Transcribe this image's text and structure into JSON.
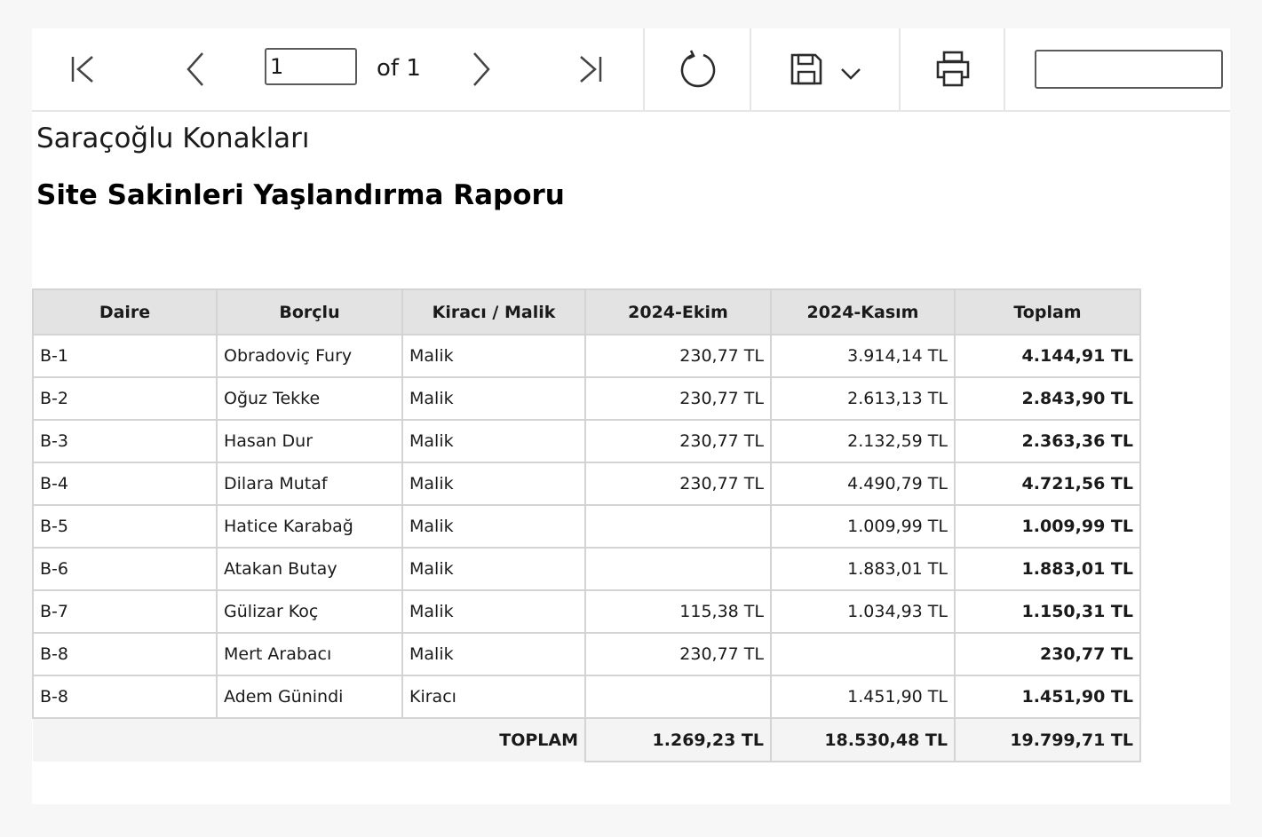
{
  "toolbar": {
    "page_value": "1",
    "page_total_label": "of 1",
    "search_value": ""
  },
  "report": {
    "company": "Saraçoğlu Konakları",
    "title": "Site Sakinleri Yaşlandırma Raporu"
  },
  "table": {
    "headers": [
      "Daire",
      "Borçlu",
      "Kiracı / Malik",
      "2024-Ekim",
      "2024-Kasım",
      "Toplam"
    ],
    "rows": [
      [
        "B-1",
        "Obradoviç Fury",
        "Malik",
        "230,77 TL",
        "3.914,14 TL",
        "4.144,91 TL"
      ],
      [
        "B-2",
        "Oğuz Tekke",
        "Malik",
        "230,77 TL",
        "2.613,13 TL",
        "2.843,90 TL"
      ],
      [
        "B-3",
        "Hasan Dur",
        "Malik",
        "230,77 TL",
        "2.132,59 TL",
        "2.363,36 TL"
      ],
      [
        "B-4",
        "Dilara Mutaf",
        "Malik",
        "230,77 TL",
        "4.490,79 TL",
        "4.721,56 TL"
      ],
      [
        "B-5",
        "Hatice Karabağ",
        "Malik",
        "",
        "1.009,99 TL",
        "1.009,99 TL"
      ],
      [
        "B-6",
        "Atakan Butay",
        "Malik",
        "",
        "1.883,01 TL",
        "1.883,01 TL"
      ],
      [
        "B-7",
        "Gülizar Koç",
        "Malik",
        "115,38 TL",
        "1.034,93 TL",
        "1.150,31 TL"
      ],
      [
        "B-8",
        "Mert Arabacı",
        "Malik",
        "230,77 TL",
        "",
        "230,77 TL"
      ],
      [
        "B-8",
        "Adem Günindi",
        "Kiracı",
        "",
        "1.451,90 TL",
        "1.451,90 TL"
      ]
    ],
    "total": {
      "label": "TOPLAM",
      "ekim": "1.269,23 TL",
      "kasim": "18.530,48 TL",
      "toplam": "19.799,71 TL"
    }
  },
  "icons": {
    "first_page": "first-page-icon",
    "previous_page": "chevron-left-icon",
    "next_page": "chevron-right-icon",
    "last_page": "last-page-icon",
    "refresh": "refresh-icon",
    "save": "save-icon",
    "save_dropdown": "chevron-down-icon",
    "print": "print-icon"
  },
  "colors": {
    "header_bg": "#e3e3e3",
    "border": "#d4d4d4",
    "icon": "#2b2b2b"
  }
}
